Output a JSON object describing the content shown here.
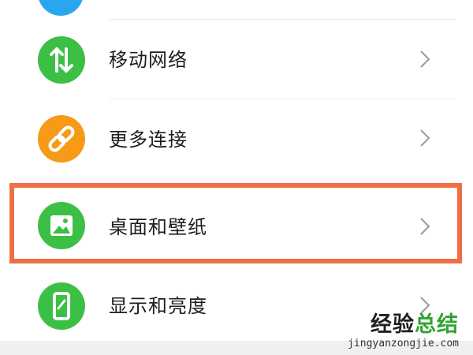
{
  "settings_list": {
    "items": [
      {
        "label": "移动网络",
        "icon": "swap-arrows-icon",
        "icon_color": "#3cbf45"
      },
      {
        "label": "更多连接",
        "icon": "link-icon",
        "icon_color": "#f69a17"
      },
      {
        "label": "桌面和壁纸",
        "icon": "image-icon",
        "icon_color": "#3cbf45"
      },
      {
        "label": "显示和亮度",
        "icon": "phone-display-icon",
        "icon_color": "#3cbf45"
      }
    ]
  },
  "highlight": {
    "color": "#ee6f44",
    "target_label": "桌面和壁纸"
  },
  "watermark": {
    "part1": "经验",
    "part2": "总结",
    "url": "jingyanzongjie.com"
  }
}
